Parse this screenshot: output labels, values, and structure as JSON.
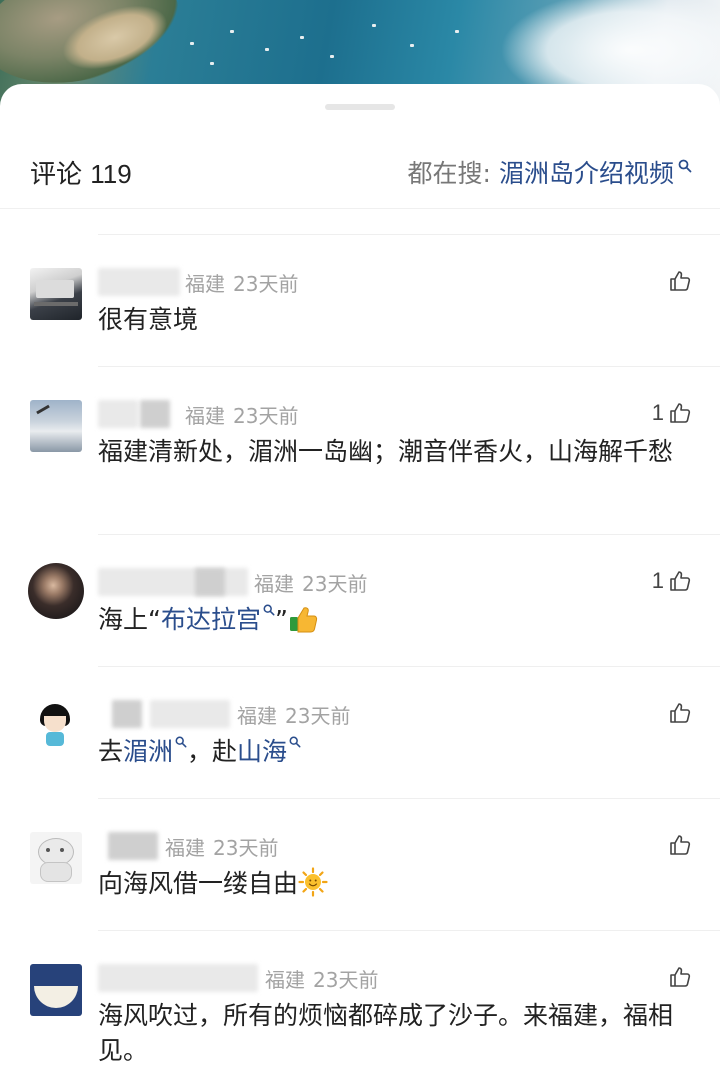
{
  "header": {
    "title": "评论",
    "count": "119",
    "search_label": "都在搜:",
    "search_term": "湄洲岛介绍视频"
  },
  "comments": [
    {
      "location": "福建",
      "time": "23天前",
      "text": "很有意境",
      "likes": ""
    },
    {
      "location": "福建",
      "time": "23天前",
      "text": "福建清新处，湄洲一岛幽；潮音伴香火，山海解千愁",
      "likes": "1"
    },
    {
      "location": "福建",
      "time": "23天前",
      "text_before": "海上“",
      "link": "布达拉宫",
      "text_after": "”",
      "emoji": "thumbs-up-emoji",
      "likes": "1"
    },
    {
      "location": "福建",
      "time": "23天前",
      "text_before": "去",
      "link1": "湄洲",
      "text_mid": "，赴",
      "link2": "山海",
      "likes": ""
    },
    {
      "location": "福建",
      "time": "23天前",
      "text": "向海风借一缕自由",
      "emoji": "sun-emoji",
      "likes": ""
    },
    {
      "location": "福建",
      "time": "23天前",
      "text": "海风吹过，所有的烦恼都碎成了沙子。来福建，福相见。",
      "likes": ""
    }
  ],
  "colors": {
    "link": "#2a4d8c",
    "meta": "#a3a3a3",
    "text": "#222222"
  }
}
